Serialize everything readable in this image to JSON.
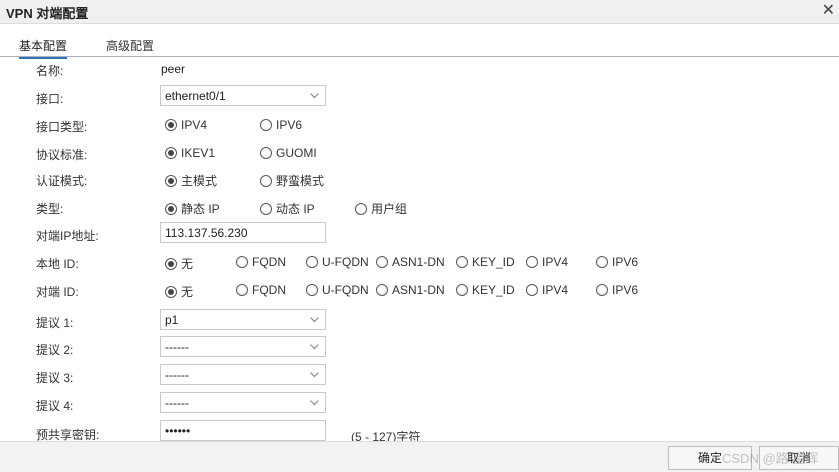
{
  "window": {
    "title": "VPN 对端配置",
    "close_glyph": "✕"
  },
  "tabs": [
    {
      "label": "基本配置",
      "active": true
    },
    {
      "label": "高级配置",
      "active": false
    }
  ],
  "form": {
    "name": {
      "label": "名称:",
      "value": "peer"
    },
    "interface": {
      "label": "接口:",
      "value": "ethernet0/1"
    },
    "interface_type": {
      "label": "接口类型:",
      "options": [
        "IPV4",
        "IPV6"
      ],
      "selected": "IPV4"
    },
    "protocol": {
      "label": "协议标准:",
      "options": [
        "IKEV1",
        "GUOMI"
      ],
      "selected": "IKEV1"
    },
    "auth_mode": {
      "label": "认证模式:",
      "options": [
        "主模式",
        "野蛮模式"
      ],
      "selected": "主模式"
    },
    "type": {
      "label": "类型:",
      "options": [
        "静态 IP",
        "动态 IP",
        "用户组"
      ],
      "selected": "静态 IP"
    },
    "peer_ip": {
      "label": "对端IP地址:",
      "value": "113.137.56.230"
    },
    "local_id": {
      "label": "本地 ID:",
      "options": [
        "无",
        "FQDN",
        "U-FQDN",
        "ASN1-DN",
        "KEY_ID",
        "IPV4",
        "IPV6"
      ],
      "selected": "无"
    },
    "peer_id": {
      "label": "对端 ID:",
      "options": [
        "无",
        "FQDN",
        "U-FQDN",
        "ASN1-DN",
        "KEY_ID",
        "IPV4",
        "IPV6"
      ],
      "selected": "无"
    },
    "proposal1": {
      "label": "提议 1:",
      "value": "p1"
    },
    "proposal2": {
      "label": "提议 2:",
      "value": "------"
    },
    "proposal3": {
      "label": "提议 3:",
      "value": "------"
    },
    "proposal4": {
      "label": "提议 4:",
      "value": "------"
    },
    "psk": {
      "label": "预共享密钥:",
      "value": "••••••",
      "hint": "(5 - 127)字符"
    }
  },
  "footer": {
    "ok_label": "确定",
    "cancel_label": "取消"
  },
  "watermark": "CSDN @路 星辉"
}
